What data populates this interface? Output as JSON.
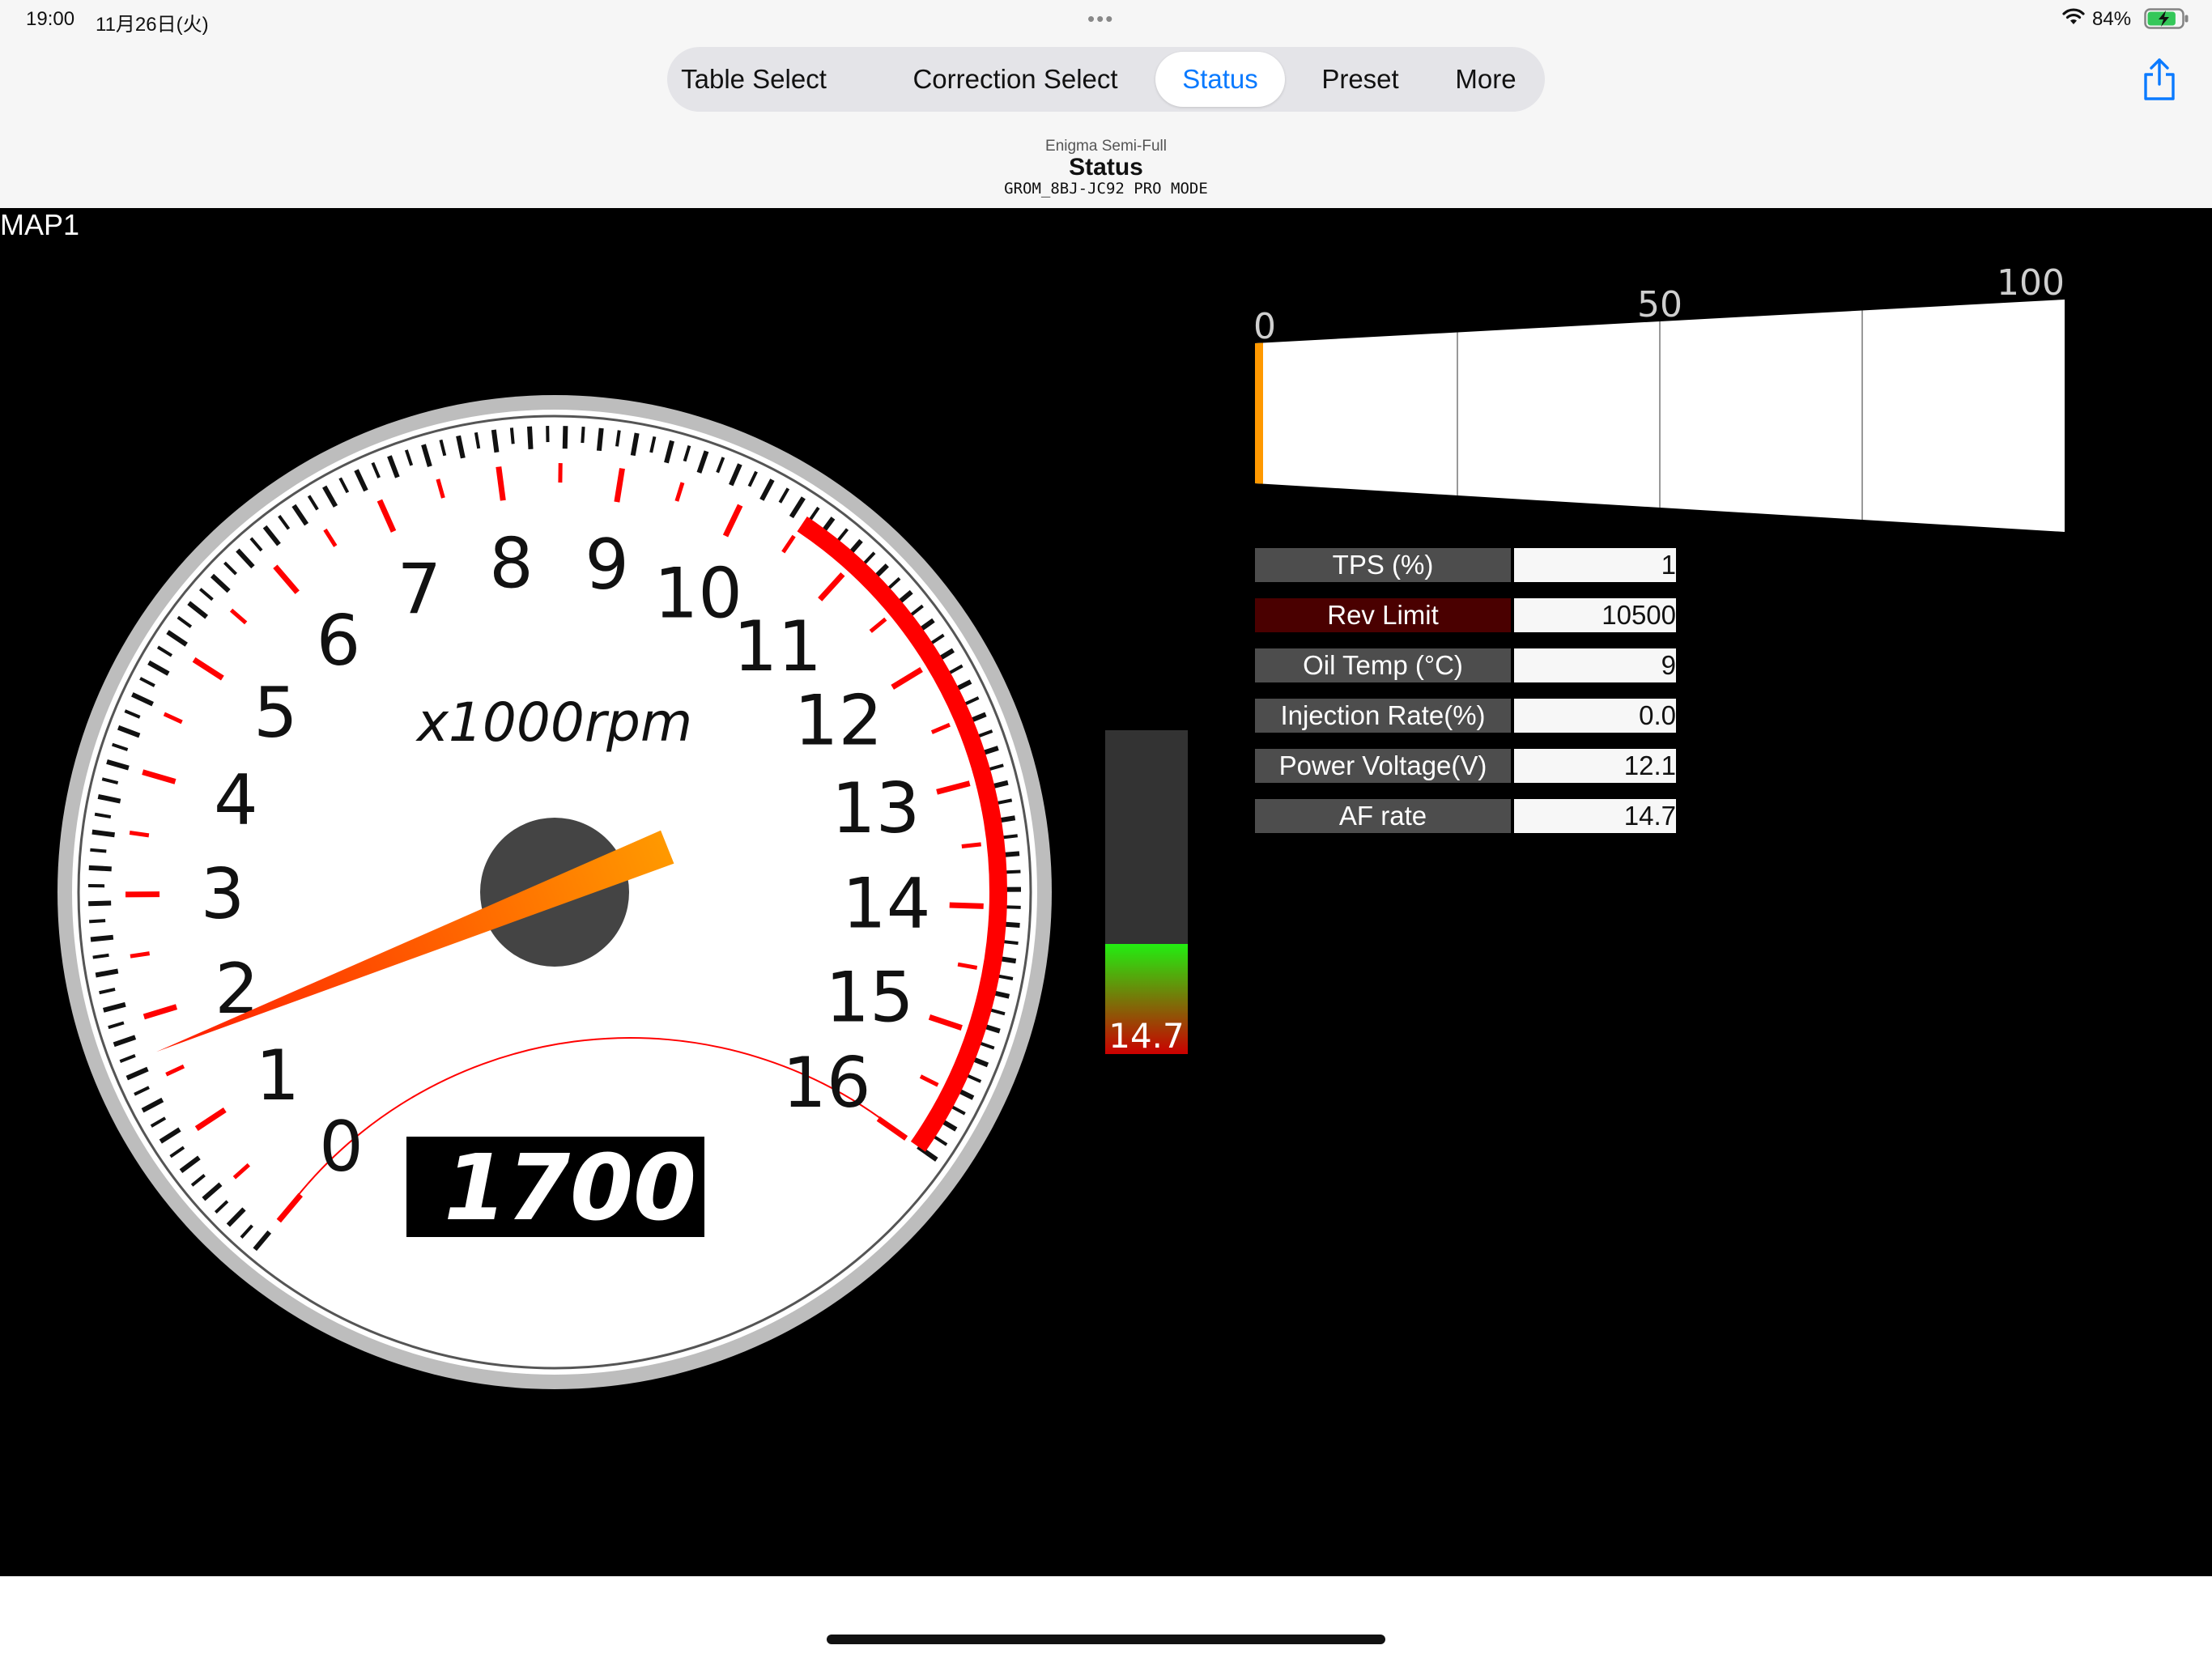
{
  "status_bar": {
    "time": "19:00",
    "date": "11月26日(火)",
    "dots": "•••",
    "battery_percent": "84%",
    "battery_level": 0.84,
    "charging": true,
    "icons": [
      "wifi-icon",
      "battery-charging-icon"
    ]
  },
  "nav": {
    "tabs": [
      {
        "label": "Table Select",
        "active": false
      },
      {
        "label": "Correction Select",
        "active": false
      },
      {
        "label": "Status",
        "active": true
      },
      {
        "label": "Preset",
        "active": false
      },
      {
        "label": "More",
        "active": false
      }
    ],
    "share_icon": "share-icon",
    "accent_color": "#0a7aff"
  },
  "header": {
    "subtitle": "Enigma Semi-Full",
    "title": "Status",
    "mode": "GROM_8BJ-JC92 PRO MODE"
  },
  "map_label": "MAP1",
  "tachometer": {
    "unit_label": "x1000rpm",
    "scale_labels": [
      "0",
      "1",
      "2",
      "3",
      "4",
      "5",
      "6",
      "7",
      "8",
      "9",
      "10",
      "11",
      "12",
      "13",
      "14",
      "15",
      "16"
    ],
    "rpm_readout": "1700",
    "rpm_value": 1700,
    "max_rpm": 16000,
    "redline_start_rpm": 10500,
    "needle_color_start": "#ff1a00",
    "needle_color_end": "#ff9900",
    "redline_color": "#ff0000"
  },
  "throttle_bar": {
    "scale_labels": [
      "0",
      "50",
      "100"
    ],
    "value_percent": 1,
    "indicator_color": "#ff9900"
  },
  "af_gauge": {
    "readout": "14.7",
    "fill_fraction": 0.34,
    "colors": {
      "top": "#22ee11",
      "bottom": "#cc0000",
      "empty": "#333333"
    }
  },
  "readings": [
    {
      "label": "TPS (%)",
      "value": "1",
      "highlight": false
    },
    {
      "label": "Rev Limit",
      "value": "10500",
      "highlight": true
    },
    {
      "label": "Oil Temp (°C)",
      "value": "9",
      "highlight": false
    },
    {
      "label": "Injection Rate(%)",
      "value": "0.0",
      "highlight": false
    },
    {
      "label": "Power Voltage(V)",
      "value": "12.1",
      "highlight": false
    },
    {
      "label": "AF rate",
      "value": "14.7",
      "highlight": false
    }
  ]
}
